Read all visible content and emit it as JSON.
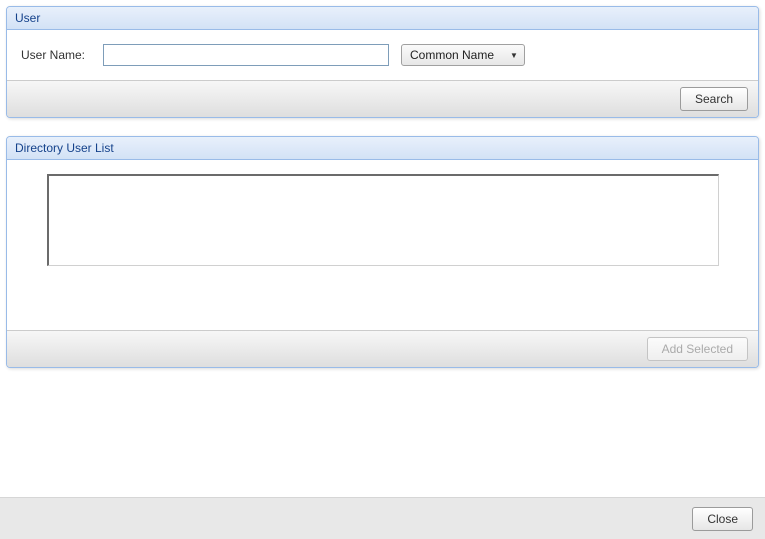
{
  "user_panel": {
    "title": "User",
    "username_label": "User Name:",
    "username_value": "",
    "dropdown_label": "Common Name",
    "search_label": "Search"
  },
  "list_panel": {
    "title": "Directory User List",
    "add_selected_label": "Add Selected"
  },
  "footer": {
    "close_label": "Close"
  }
}
